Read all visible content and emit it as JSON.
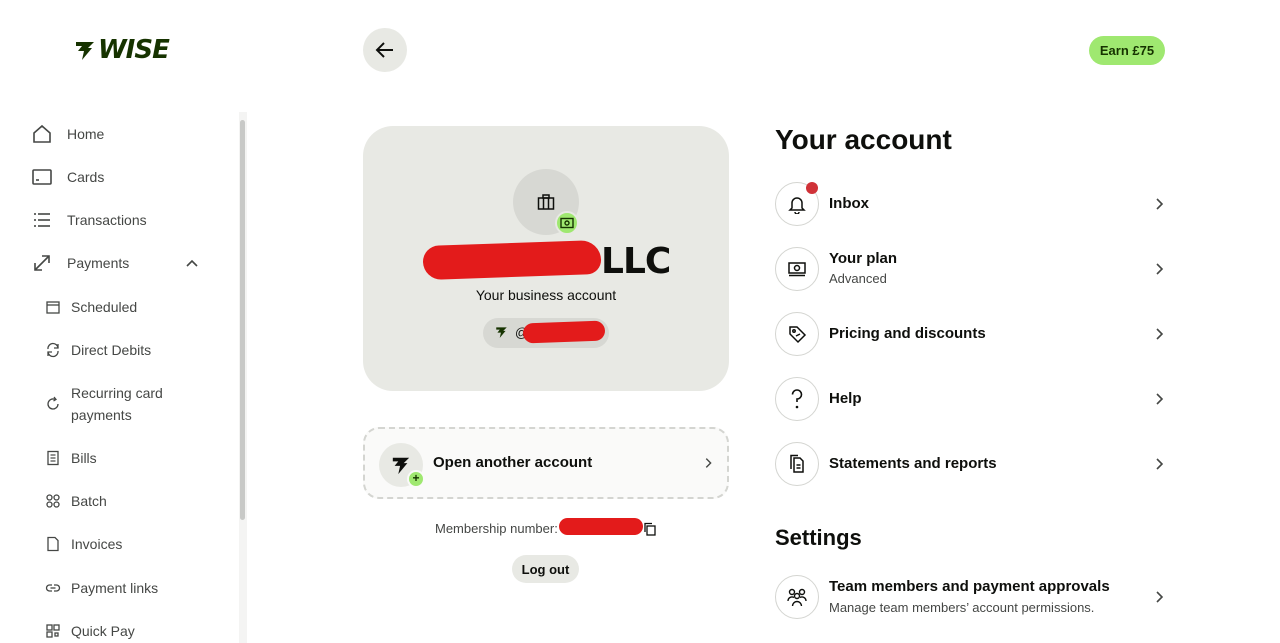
{
  "brand": {
    "name": "WISE"
  },
  "sidebar": {
    "items": [
      {
        "label": "Home",
        "icon": "home-icon"
      },
      {
        "label": "Cards",
        "icon": "card-icon"
      },
      {
        "label": "Transactions",
        "icon": "list-icon"
      },
      {
        "label": "Payments",
        "icon": "payments-icon"
      }
    ],
    "payments_sub": [
      {
        "label": "Scheduled",
        "icon": "calendar-icon"
      },
      {
        "label": "Direct Debits",
        "icon": "refresh-icon"
      },
      {
        "label": "Recurring card",
        "label2": "payments",
        "icon": "recurring-icon"
      },
      {
        "label": "Bills",
        "icon": "bill-icon"
      },
      {
        "label": "Batch",
        "icon": "batch-icon"
      },
      {
        "label": "Invoices",
        "icon": "invoice-icon"
      },
      {
        "label": "Payment links",
        "icon": "link-icon"
      },
      {
        "label": "Quick Pay",
        "icon": "qr-icon"
      }
    ]
  },
  "header": {
    "earn_label": "Earn £75"
  },
  "profile": {
    "name_suffix": "LLC",
    "subtitle": "Your business account",
    "handle_prefix": "@"
  },
  "open_account": {
    "label": "Open another account"
  },
  "membership": {
    "label": "Membership number:"
  },
  "logout": {
    "label": "Log out"
  },
  "account": {
    "title": "Your account",
    "rows": [
      {
        "title": "Inbox",
        "icon": "bell-icon"
      },
      {
        "title": "Your plan",
        "subtitle": "Advanced",
        "icon": "plan-icon"
      },
      {
        "title": "Pricing and discounts",
        "icon": "tag-icon"
      },
      {
        "title": "Help",
        "icon": "help-icon"
      },
      {
        "title": "Statements and reports",
        "icon": "documents-icon"
      }
    ]
  },
  "settings": {
    "title": "Settings",
    "rows": [
      {
        "title": "Team members and payment approvals",
        "subtitle": "Manage team members’ account permissions.",
        "icon": "team-icon"
      }
    ]
  },
  "colors": {
    "accent": "#9fe870",
    "brand_dark": "#163300",
    "panel": "#e8e9e4",
    "notification": "#d03238"
  }
}
